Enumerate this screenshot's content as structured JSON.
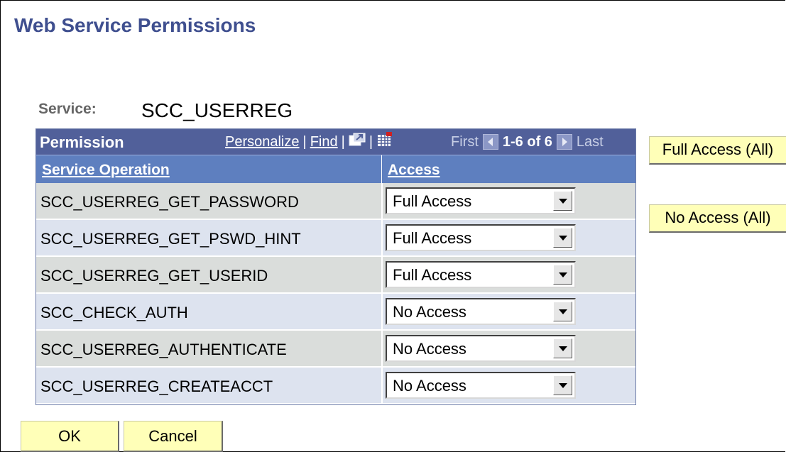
{
  "page": {
    "title": "Web Service Permissions"
  },
  "service": {
    "label": "Service:",
    "value": "SCC_USERREG"
  },
  "grid": {
    "title": "Permission",
    "personalize": "Personalize",
    "find": "Find",
    "first": "First",
    "range": "1-6 of 6",
    "last": "Last",
    "col_operation": "Service Operation",
    "col_access": "Access",
    "rows": [
      {
        "operation": "SCC_USERREG_GET_PASSWORD",
        "access": "Full Access"
      },
      {
        "operation": "SCC_USERREG_GET_PSWD_HINT",
        "access": "Full Access"
      },
      {
        "operation": "SCC_USERREG_GET_USERID",
        "access": "Full Access"
      },
      {
        "operation": "SCC_CHECK_AUTH",
        "access": "No Access"
      },
      {
        "operation": "SCC_USERREG_AUTHENTICATE",
        "access": "No Access"
      },
      {
        "operation": "SCC_USERREG_CREATEACCT",
        "access": "No Access"
      }
    ]
  },
  "buttons": {
    "full_all": "Full Access (All)",
    "no_all": "No Access (All)",
    "ok": "OK",
    "cancel": "Cancel"
  },
  "colors": {
    "title": "#3f4f8f",
    "header": "#51609a",
    "col_header": "#5e7fbf",
    "row_even": "#dadddb",
    "row_odd": "#dde3ef",
    "button": "#ffffb8"
  }
}
